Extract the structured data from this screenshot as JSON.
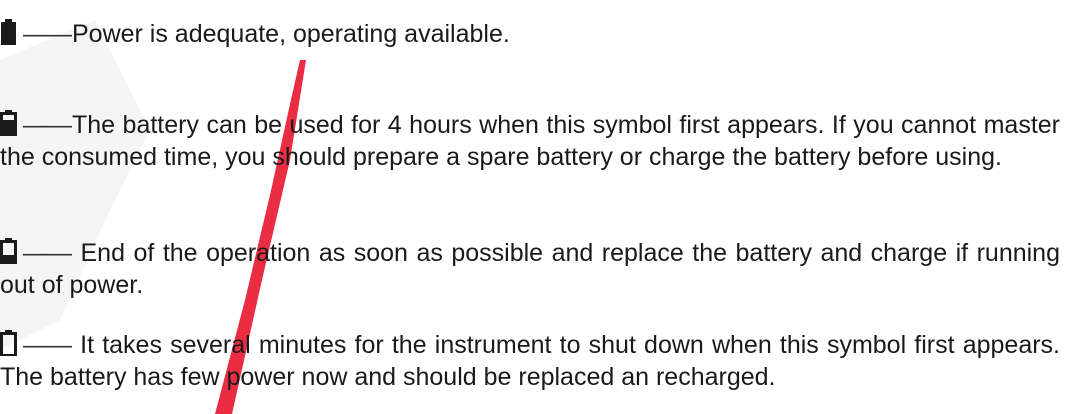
{
  "dash": "——",
  "icons": {
    "full": "battery-full-icon",
    "high": "battery-high-icon",
    "low": "battery-low-icon",
    "empty": "battery-empty-icon"
  },
  "colors": {
    "text": "#1a1a1a",
    "icon": "#1a1a1a",
    "watermark_red": "#e8162d",
    "watermark_grey": "#d9d9d9"
  },
  "entries": [
    {
      "text": "Power is adequate, operating available."
    },
    {
      "text": "The battery can be used for 4 hours when this symbol first appears. If you cannot master the consumed time, you should prepare a spare battery or charge the battery before using."
    },
    {
      "text": " End of the operation as soon as possible and replace the battery and charge if running out of power."
    },
    {
      "text": " It takes several minutes for the instrument to shut down when this symbol first appears. The battery has few power now and should be replaced an recharged."
    }
  ]
}
